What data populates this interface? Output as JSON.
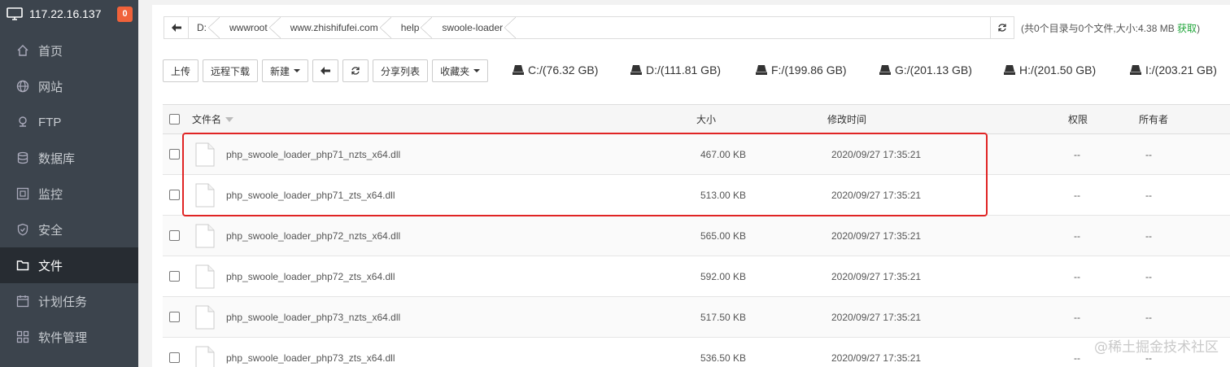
{
  "server": {
    "ip": "117.22.16.137",
    "badge": "0"
  },
  "sidebar": {
    "items": [
      {
        "label": "首页",
        "icon": "home-icon"
      },
      {
        "label": "网站",
        "icon": "globe-icon"
      },
      {
        "label": "FTP",
        "icon": "ftp-icon"
      },
      {
        "label": "数据库",
        "icon": "database-icon"
      },
      {
        "label": "监控",
        "icon": "monitor-icon"
      },
      {
        "label": "安全",
        "icon": "shield-icon"
      },
      {
        "label": "文件",
        "icon": "folder-icon",
        "active": true
      },
      {
        "label": "计划任务",
        "icon": "calendar-icon"
      },
      {
        "label": "软件管理",
        "icon": "apps-icon"
      }
    ]
  },
  "path": {
    "crumbs": [
      "D:",
      "wwwroot",
      "www.zhishifufei.com",
      "help",
      "swoole-loader"
    ]
  },
  "summary": {
    "text": "(共0个目录与0个文件,大小:4.38 MB ",
    "link": "获取",
    "close": ")"
  },
  "toolbar": {
    "upload": "上传",
    "remote_download": "远程下载",
    "new": "新建",
    "share_list": "分享列表",
    "favorites": "收藏夹"
  },
  "drives": [
    "C:/(76.32 GB)",
    "D:/(111.81 GB)",
    "F:/(199.86 GB)",
    "G:/(201.13 GB)",
    "H:/(201.50 GB)",
    "I:/(203.21 GB)"
  ],
  "table": {
    "headers": {
      "name": "文件名",
      "size": "大小",
      "mtime": "修改时间",
      "perm": "权限",
      "owner": "所有者"
    },
    "rows": [
      {
        "name": "php_swoole_loader_php71_nzts_x64.dll",
        "size": "467.00 KB",
        "mtime": "2020/09/27 17:35:21",
        "perm": "--",
        "owner": "--"
      },
      {
        "name": "php_swoole_loader_php71_zts_x64.dll",
        "size": "513.00 KB",
        "mtime": "2020/09/27 17:35:21",
        "perm": "--",
        "owner": "--"
      },
      {
        "name": "php_swoole_loader_php72_nzts_x64.dll",
        "size": "565.00 KB",
        "mtime": "2020/09/27 17:35:21",
        "perm": "--",
        "owner": "--"
      },
      {
        "name": "php_swoole_loader_php72_zts_x64.dll",
        "size": "592.00 KB",
        "mtime": "2020/09/27 17:35:21",
        "perm": "--",
        "owner": "--"
      },
      {
        "name": "php_swoole_loader_php73_nzts_x64.dll",
        "size": "517.50 KB",
        "mtime": "2020/09/27 17:35:21",
        "perm": "--",
        "owner": "--"
      },
      {
        "name": "php_swoole_loader_php73_zts_x64.dll",
        "size": "536.50 KB",
        "mtime": "2020/09/27 17:35:21",
        "perm": "--",
        "owner": "--"
      }
    ]
  },
  "watermark": "@稀土掘金技术社区",
  "colors": {
    "sidebar_bg": "#3c444d",
    "sidebar_active": "#272c32",
    "badge": "#f0623a",
    "link": "#20a53a",
    "highlight": "#e02424"
  }
}
